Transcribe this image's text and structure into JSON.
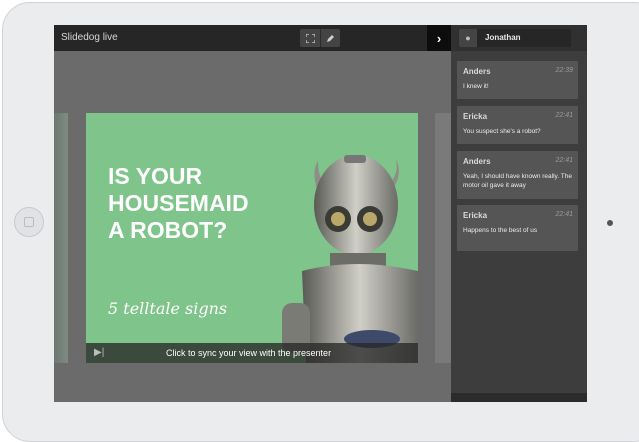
{
  "app": {
    "title": "Slidedog live"
  },
  "toolbar": {
    "fullscreen_icon": "fullscreen-icon",
    "pen_icon": "pen-icon",
    "toggle_icon": "chevron-right-icon"
  },
  "slide": {
    "title_lines": [
      "IS YOUR",
      "HOUSEMAID",
      "A ROBOT?"
    ],
    "subtitle": "5 telltale signs",
    "background": "#7fc48a"
  },
  "sync": {
    "text": "Click to sync your view with the presenter",
    "icon": "skip-icon"
  },
  "chat": {
    "user": {
      "name": "Jonathan",
      "icon": "user-icon"
    },
    "messages": [
      {
        "author": "Anders",
        "time": "22:39",
        "text": "I knew it!"
      },
      {
        "author": "Ericka",
        "time": "22:41",
        "text": "You suspect she's a robot?"
      },
      {
        "author": "Anders",
        "time": "22:41",
        "text": "Yeah, I should have known really. The motor oil gave it away"
      },
      {
        "author": "Ericka",
        "time": "22:41",
        "text": "Happens to the best of us"
      }
    ]
  }
}
